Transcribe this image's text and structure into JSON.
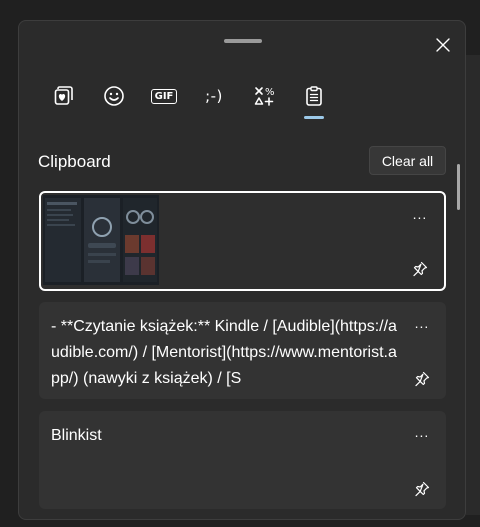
{
  "header": {
    "close_icon": "close-icon"
  },
  "tabs": [
    {
      "name": "favorites",
      "icon": "heart-stack-icon"
    },
    {
      "name": "emoji",
      "icon": "smiley-icon"
    },
    {
      "name": "gif",
      "label": "GIF",
      "icon": "gif-icon"
    },
    {
      "name": "kaomoji",
      "label": ";-)",
      "icon": "kaomoji-icon"
    },
    {
      "name": "symbols",
      "icon": "symbols-icon"
    },
    {
      "name": "clipboard",
      "icon": "clipboard-icon",
      "active": true
    }
  ],
  "clipboard": {
    "title": "Clipboard",
    "clear_label": "Clear all",
    "items": [
      {
        "type": "image",
        "description_icon": "screenshot-thumbnail",
        "more": "...",
        "pin_icon": "pin-icon"
      },
      {
        "type": "text",
        "text": "-   **Czytanie książek:** Kindle / [Audible](https://audible.com/) / [Mentorist](https://www.mentorist.app/) (nawyki z książek) / [S",
        "more": "...",
        "pin_icon": "pin-icon"
      },
      {
        "type": "text",
        "text": "Blinkist",
        "more": "...",
        "pin_icon": "pin-icon"
      }
    ]
  },
  "colors": {
    "panel_bg": "#2b2b2b",
    "card_bg": "#333333",
    "accent": "#9cc9e8",
    "text": "#ffffff"
  }
}
